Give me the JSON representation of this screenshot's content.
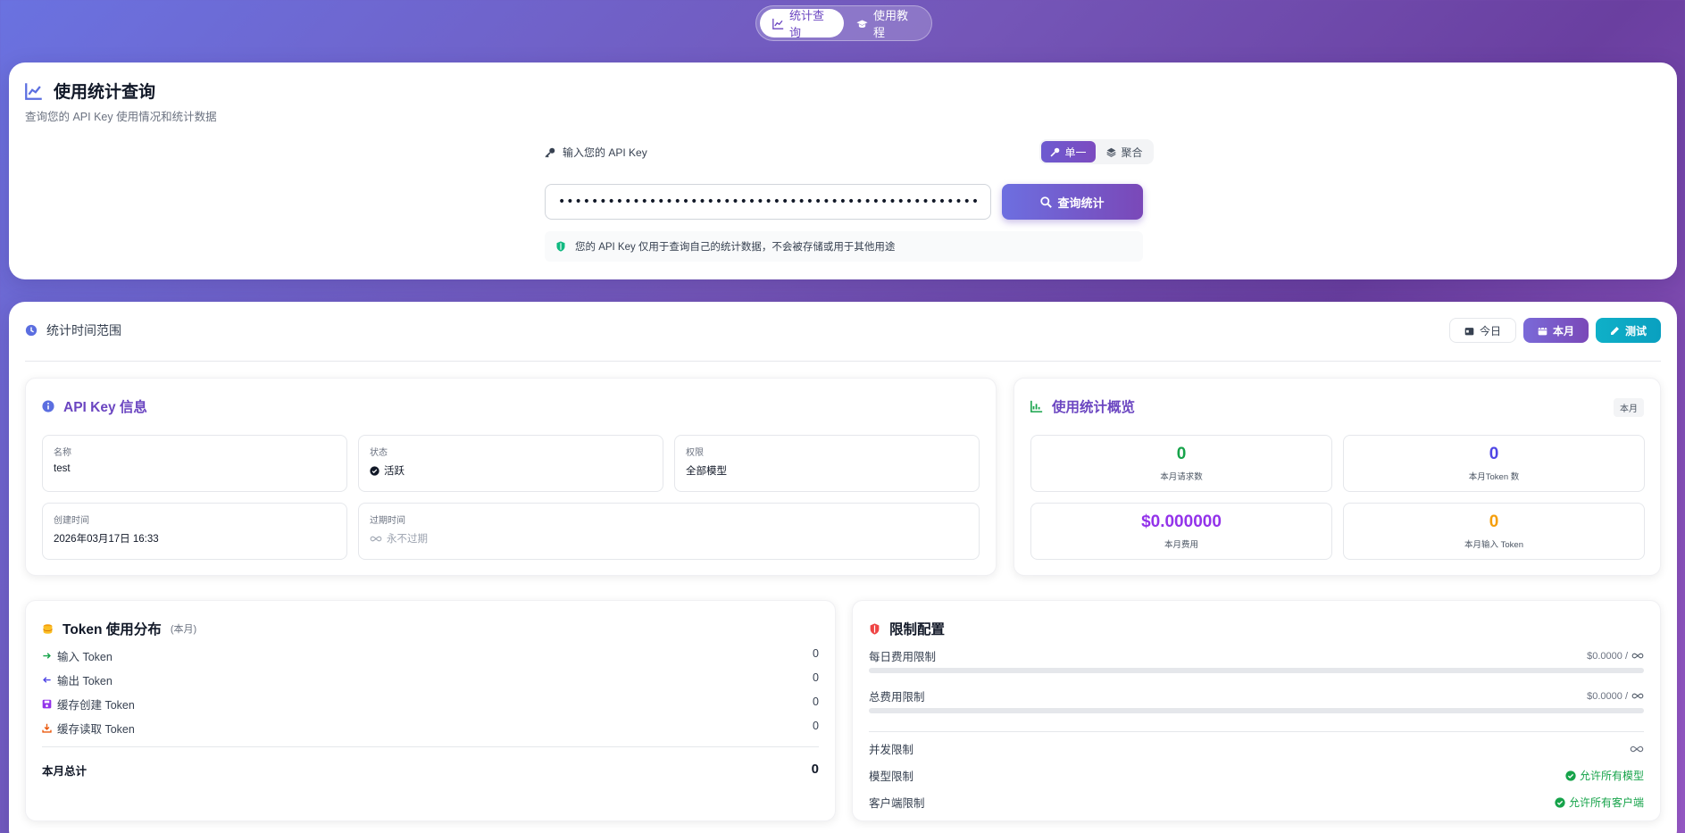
{
  "nav": {
    "tabs": [
      {
        "label": "统计查询",
        "icon": "chart-line-icon"
      },
      {
        "label": "使用教程",
        "icon": "graduation-cap-icon"
      }
    ]
  },
  "query": {
    "title": "使用统计查询",
    "subtitle": "查询您的 API Key 使用情况和统计数据",
    "key_label": "输入您的 API Key",
    "mode_single": "单一",
    "mode_aggregate": "聚合",
    "key_value": "••••••••••••••••••••••••••••••••••••••••••••••••••••••••••••••••••••",
    "button": "查询统计",
    "notice": "您的 API Key 仅用于查询自己的统计数据，不会被存储或用于其他用途"
  },
  "range": {
    "label": "统计时间范围",
    "today": "今日",
    "month": "本月",
    "test": "测试"
  },
  "info": {
    "title": "API Key 信息",
    "name_label": "名称",
    "name_value": "test",
    "status_label": "状态",
    "status_value": "活跃",
    "perm_label": "权限",
    "perm_value": "全部模型",
    "created_label": "创建时间",
    "created_value": "2026年03月17日 16:33",
    "expire_label": "过期时间",
    "expire_value": "永不过期"
  },
  "overview": {
    "title": "使用统计概览",
    "badge": "本月",
    "requests_value": "0",
    "requests_label": "本月请求数",
    "tokens_value": "0",
    "tokens_label": "本月Token 数",
    "cost_value": "$0.000000",
    "cost_label": "本月费用",
    "input_value": "0",
    "input_label": "本月输入 Token"
  },
  "token": {
    "title": "Token 使用分布",
    "tag": "(本月)",
    "rows": [
      {
        "label": "输入 Token",
        "value": "0"
      },
      {
        "label": "输出 Token",
        "value": "0"
      },
      {
        "label": "缓存创建 Token",
        "value": "0"
      },
      {
        "label": "缓存读取 Token",
        "value": "0"
      }
    ],
    "total_label": "本月总计",
    "total_value": "0"
  },
  "limits": {
    "title": "限制配置",
    "daily_label": "每日费用限制",
    "daily_value": "$0.0000 /",
    "daily_progress": 0,
    "total_label": "总费用限制",
    "total_value": "$0.0000 /",
    "total_progress": 0,
    "concurrency_label": "并发限制",
    "model_label": "模型限制",
    "model_value": "允许所有模型",
    "client_label": "客户端限制",
    "client_value": "允许所有客户端"
  },
  "colors": {
    "accent": "#6b46c1",
    "green": "#16a34a",
    "blue": "#4f46e5",
    "purple": "#9333ea",
    "orange": "#f59e0b",
    "cyan": "#0fb0c8"
  }
}
